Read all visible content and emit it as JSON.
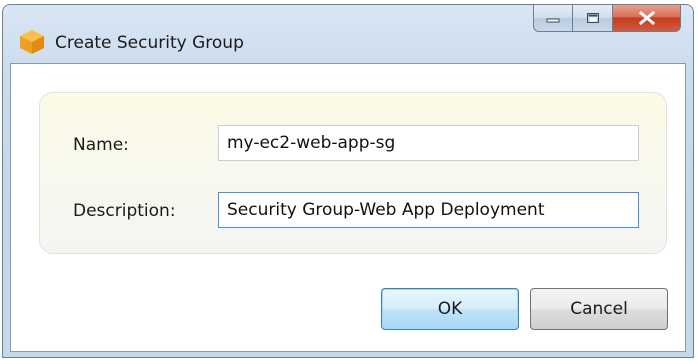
{
  "window": {
    "title": "Create Security Group"
  },
  "form": {
    "name_label": "Name:",
    "name_value": "my-ec2-web-app-sg",
    "description_label": "Description:",
    "description_value": "Security Group-Web App Deployment"
  },
  "buttons": {
    "ok_label": "OK",
    "cancel_label": "Cancel"
  },
  "colors": {
    "close_button": "#c43c1e",
    "ok_border": "#3c7fb1",
    "input_focus_border": "#4b8fd6"
  }
}
